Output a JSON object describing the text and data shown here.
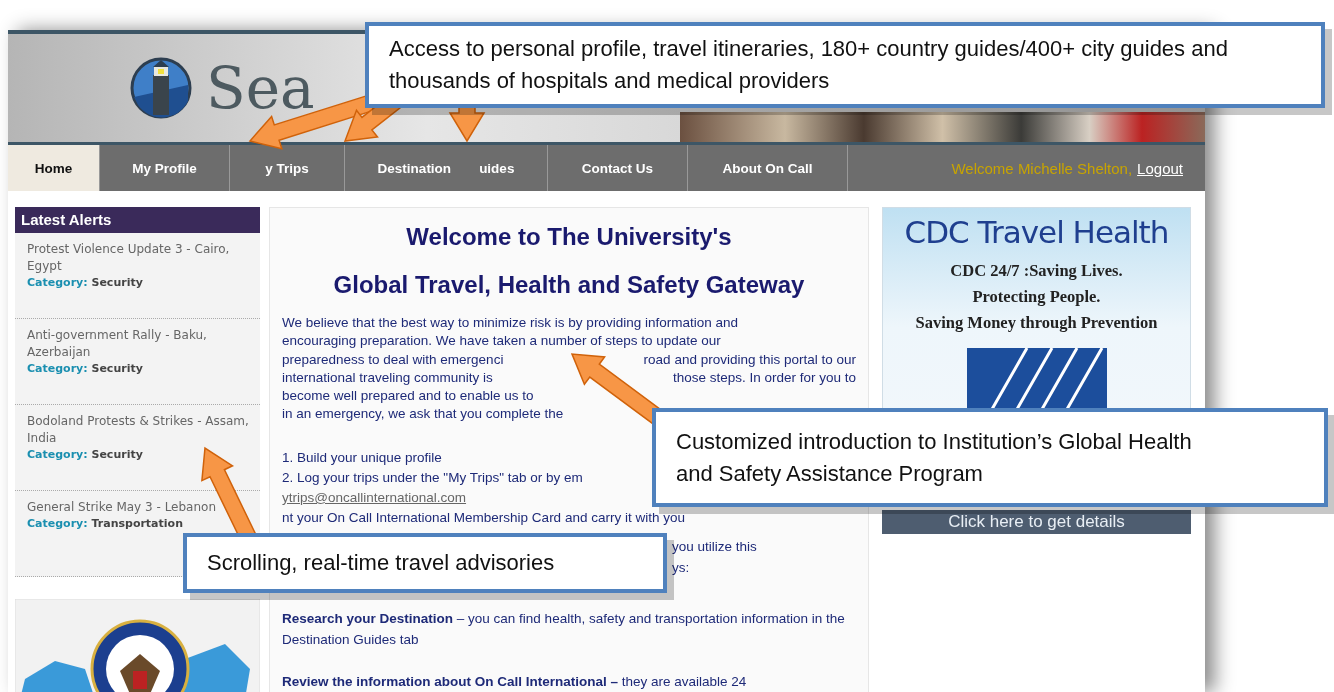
{
  "header": {
    "logo_text": "Sea"
  },
  "nav": {
    "tabs": [
      {
        "parts": [
          "Home"
        ],
        "selected": true
      },
      {
        "parts": [
          "My Profile"
        ],
        "selected": false
      },
      {
        "parts": [
          "y Trips"
        ],
        "selected": false
      },
      {
        "parts": [
          "Destination",
          "uides"
        ],
        "selected": false
      },
      {
        "parts": [
          "Contact Us"
        ],
        "selected": false
      },
      {
        "parts": [
          "About On Call"
        ],
        "selected": false
      }
    ],
    "welcome": "Welcome Michelle Shelton,",
    "logout": "Logout"
  },
  "alerts": {
    "title": "Latest Alerts",
    "items": [
      {
        "title": "Protest Violence Update 3 - Cairo, Egypt",
        "category_label": "Category:",
        "category": "Security"
      },
      {
        "title": "Anti-government Rally - Baku, Azerbaijan",
        "category_label": "Category:",
        "category": "Security"
      },
      {
        "title": "Bodoland Protests & Strikes - Assam, India",
        "category_label": "Category:",
        "category": "Security"
      },
      {
        "title": "General Strike May 3 - Lebanon",
        "category_label": "Category:",
        "category": "Transportation"
      }
    ]
  },
  "main": {
    "headings": [
      "Welcome to The University's",
      "Global Travel, Health and Safety Gateway"
    ],
    "intro_lines": [
      {
        "left": "We believe that the best way to minimize risk is by providing information and"
      },
      {
        "left": "encouraging preparation. We have taken a number of steps to update our"
      },
      {
        "left": "preparedness to deal with emergenci",
        "right": "road and providing this portal to our"
      },
      {
        "left": "international traveling community is",
        "right": "those steps. In order for you to"
      },
      {
        "left": "become well prepared and to enable us to"
      },
      {
        "left": "in an emergency, we ask that you complete the"
      }
    ],
    "steps": [
      "1. Build your unique profile",
      "2. Log your trips under the \"My Trips\" tab or by em"
    ],
    "email": "ytrips@oncallinternational.com",
    "step_3": "nt your On Call International Membership Card and carry it with you",
    "partial_lines": [
      "you utilize this",
      "ys:"
    ],
    "sections": [
      "**Research your Destination** – you can find health, safety and transportation information in the Destination Guides tab",
      "**Review the information about On Call International –** they are available 24"
    ]
  },
  "cdc": {
    "title": "CDC Travel Health",
    "tagline": [
      "CDC 24/7 :Saving Lives.",
      "Protecting People.",
      "Saving Money through Prevention"
    ],
    "button": "Click here to get details"
  },
  "callouts": [
    {
      "text": "Access to personal profile, travel itineraries, 180+ country guides/400+ city guides and thousands of hospitals and medical providers"
    },
    {
      "text": "Customized introduction to Institution’s Global Health and Safety Assistance Program"
    },
    {
      "text": "Scrolling, real-time travel advisories"
    }
  ]
}
